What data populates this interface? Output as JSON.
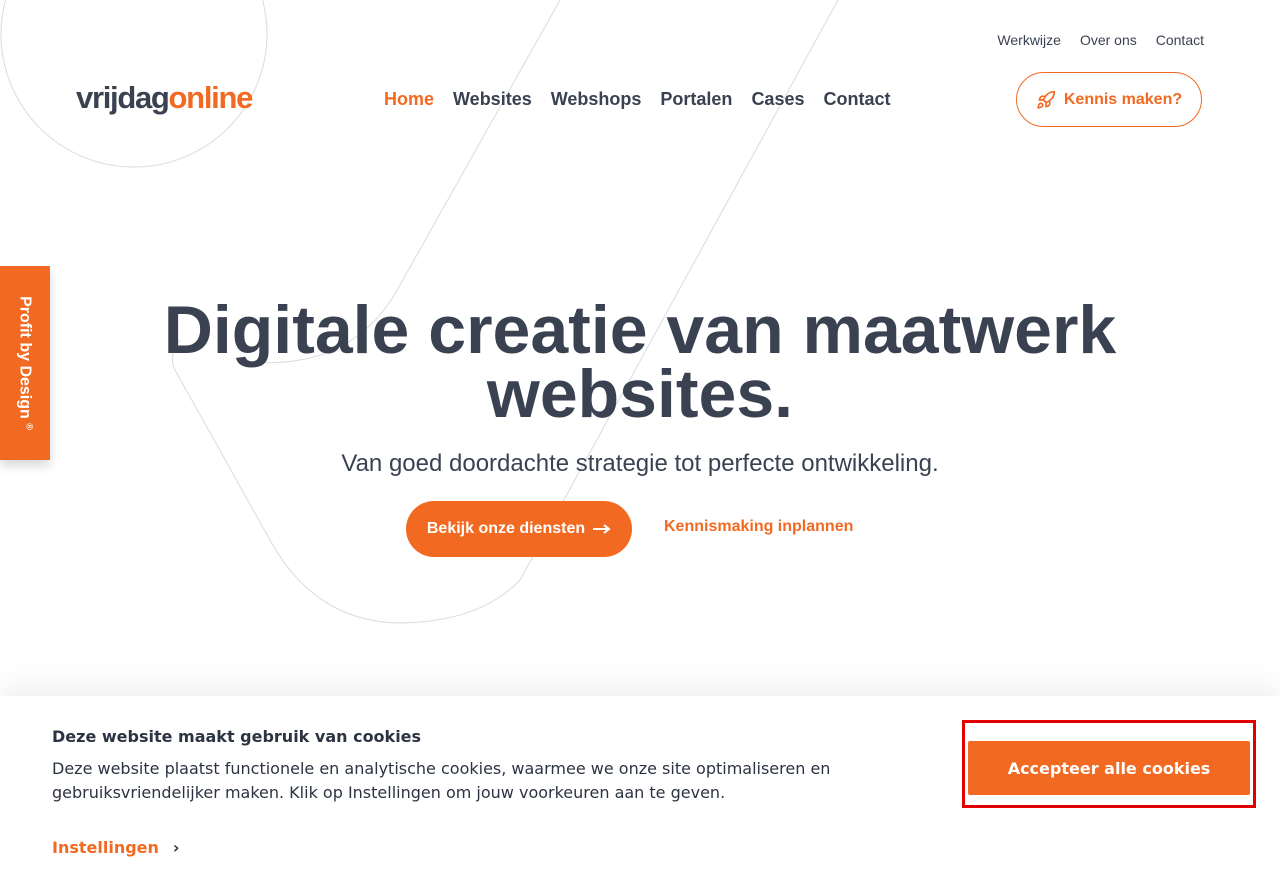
{
  "brand": {
    "part1": "vrijdag",
    "part2": "online",
    "accent": "#f26a22",
    "text": "#3a4252"
  },
  "topnav": [
    {
      "label": "Werkwijze"
    },
    {
      "label": "Over ons"
    },
    {
      "label": "Contact"
    }
  ],
  "mainnav": [
    {
      "label": "Home",
      "active": true
    },
    {
      "label": "Websites"
    },
    {
      "label": "Webshops"
    },
    {
      "label": "Portalen"
    },
    {
      "label": "Cases"
    },
    {
      "label": "Contact"
    }
  ],
  "cta": {
    "label": "Kennis maken?",
    "icon": "rocket-icon"
  },
  "sidetab": {
    "label": "Profit by Design",
    "mark": "®"
  },
  "hero": {
    "title_line1": "Digitale creatie van maatwerk",
    "title_line2": "websites.",
    "subtitle": "Van goed doordachte strategie tot perfecte ontwikkeling.",
    "primary_btn": "Bekijk onze diensten",
    "secondary_link": "Kennismaking inplannen"
  },
  "cookie": {
    "title": "Deze website maakt gebruik van cookies",
    "text": "Deze website plaatst functionele en analytische cookies, waarmee we onze site optimaliseren en gebruiksvriendelijker maken. Klik op Instellingen om jouw voorkeuren aan te geven.",
    "settings": "Instellingen",
    "accept": "Accepteer alle cookies"
  }
}
